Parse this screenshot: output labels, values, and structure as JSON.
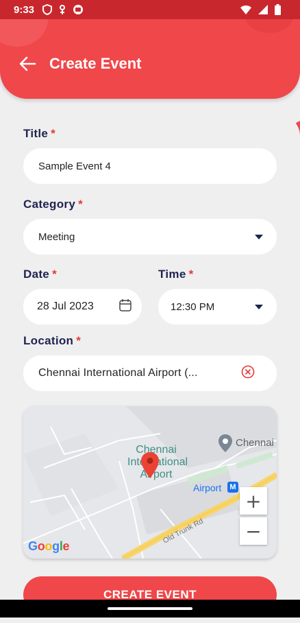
{
  "status_bar": {
    "time": "9:33",
    "icons_left": [
      "shield-icon",
      "usb-icon",
      "app-icon"
    ],
    "icons_right": [
      "wifi-icon",
      "signal-icon",
      "battery-icon"
    ]
  },
  "header": {
    "title": "Create Event",
    "back_icon": "arrow-left-icon"
  },
  "form": {
    "title": {
      "label": "Title",
      "required": "*",
      "value": "Sample Event 4"
    },
    "category": {
      "label": "Category",
      "required": "*",
      "value": "Meeting"
    },
    "date": {
      "label": "Date",
      "required": "*",
      "value": "28 Jul 2023",
      "icon": "calendar-icon"
    },
    "time": {
      "label": "Time",
      "required": "*",
      "value": "12:30 PM"
    },
    "location": {
      "label": "Location",
      "required": "*",
      "value": "Chennai International Airport (...",
      "clear_icon": "clear-circle-icon"
    }
  },
  "map": {
    "place_label": "Chennai International Airport",
    "place_line1": "Chennai",
    "place_line2": "International",
    "place_line3": "Airport",
    "city_label": "Chennai",
    "metro_label": "Airport",
    "metro_badge": "M",
    "road_label": "Old Trunk Rd",
    "attribution": "Google",
    "zoom_in": "+",
    "zoom_out": "−"
  },
  "actions": {
    "create_label": "CREATE EVENT"
  },
  "colors": {
    "primary": "#f0474a",
    "status_bar": "#c8282d",
    "label": "#1f2350",
    "required": "#e53935"
  }
}
